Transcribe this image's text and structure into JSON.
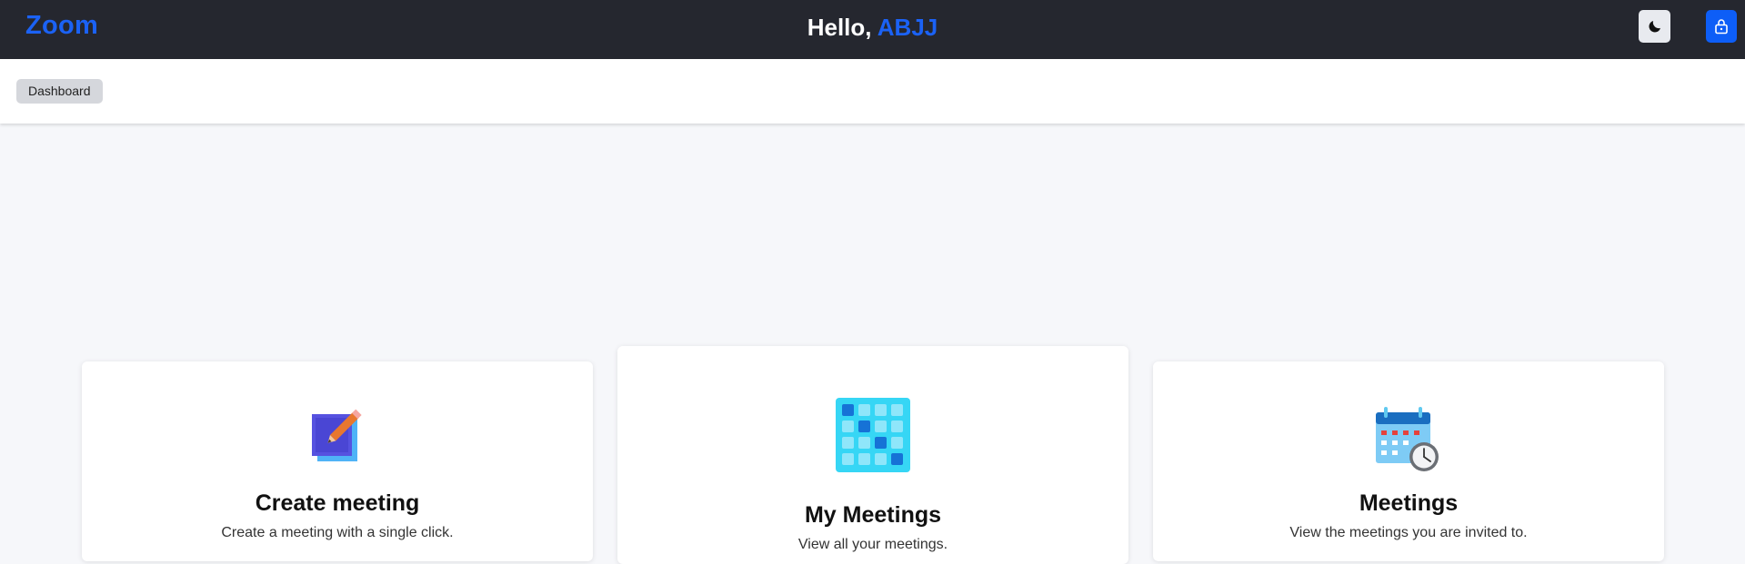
{
  "header": {
    "logo": "Zoom",
    "greeting_prefix": "Hello,",
    "user_name": "ABJJ",
    "theme_toggle_icon": "moon-icon",
    "lock_icon": "lock-icon"
  },
  "breadcrumb": {
    "label": "Dashboard"
  },
  "cards": [
    {
      "title": "Create meeting",
      "description": "Create a meeting with a single click.",
      "icon": "edit-square-icon"
    },
    {
      "title": "My Meetings",
      "description": "View all your meetings.",
      "icon": "calendar-grid-icon"
    },
    {
      "title": "Meetings",
      "description": "View the meetings you are invited to.",
      "icon": "calendar-clock-icon"
    }
  ],
  "colors": {
    "accent": "#1b62f5",
    "header_bg": "#25272f",
    "page_bg": "#f6f7fa"
  }
}
